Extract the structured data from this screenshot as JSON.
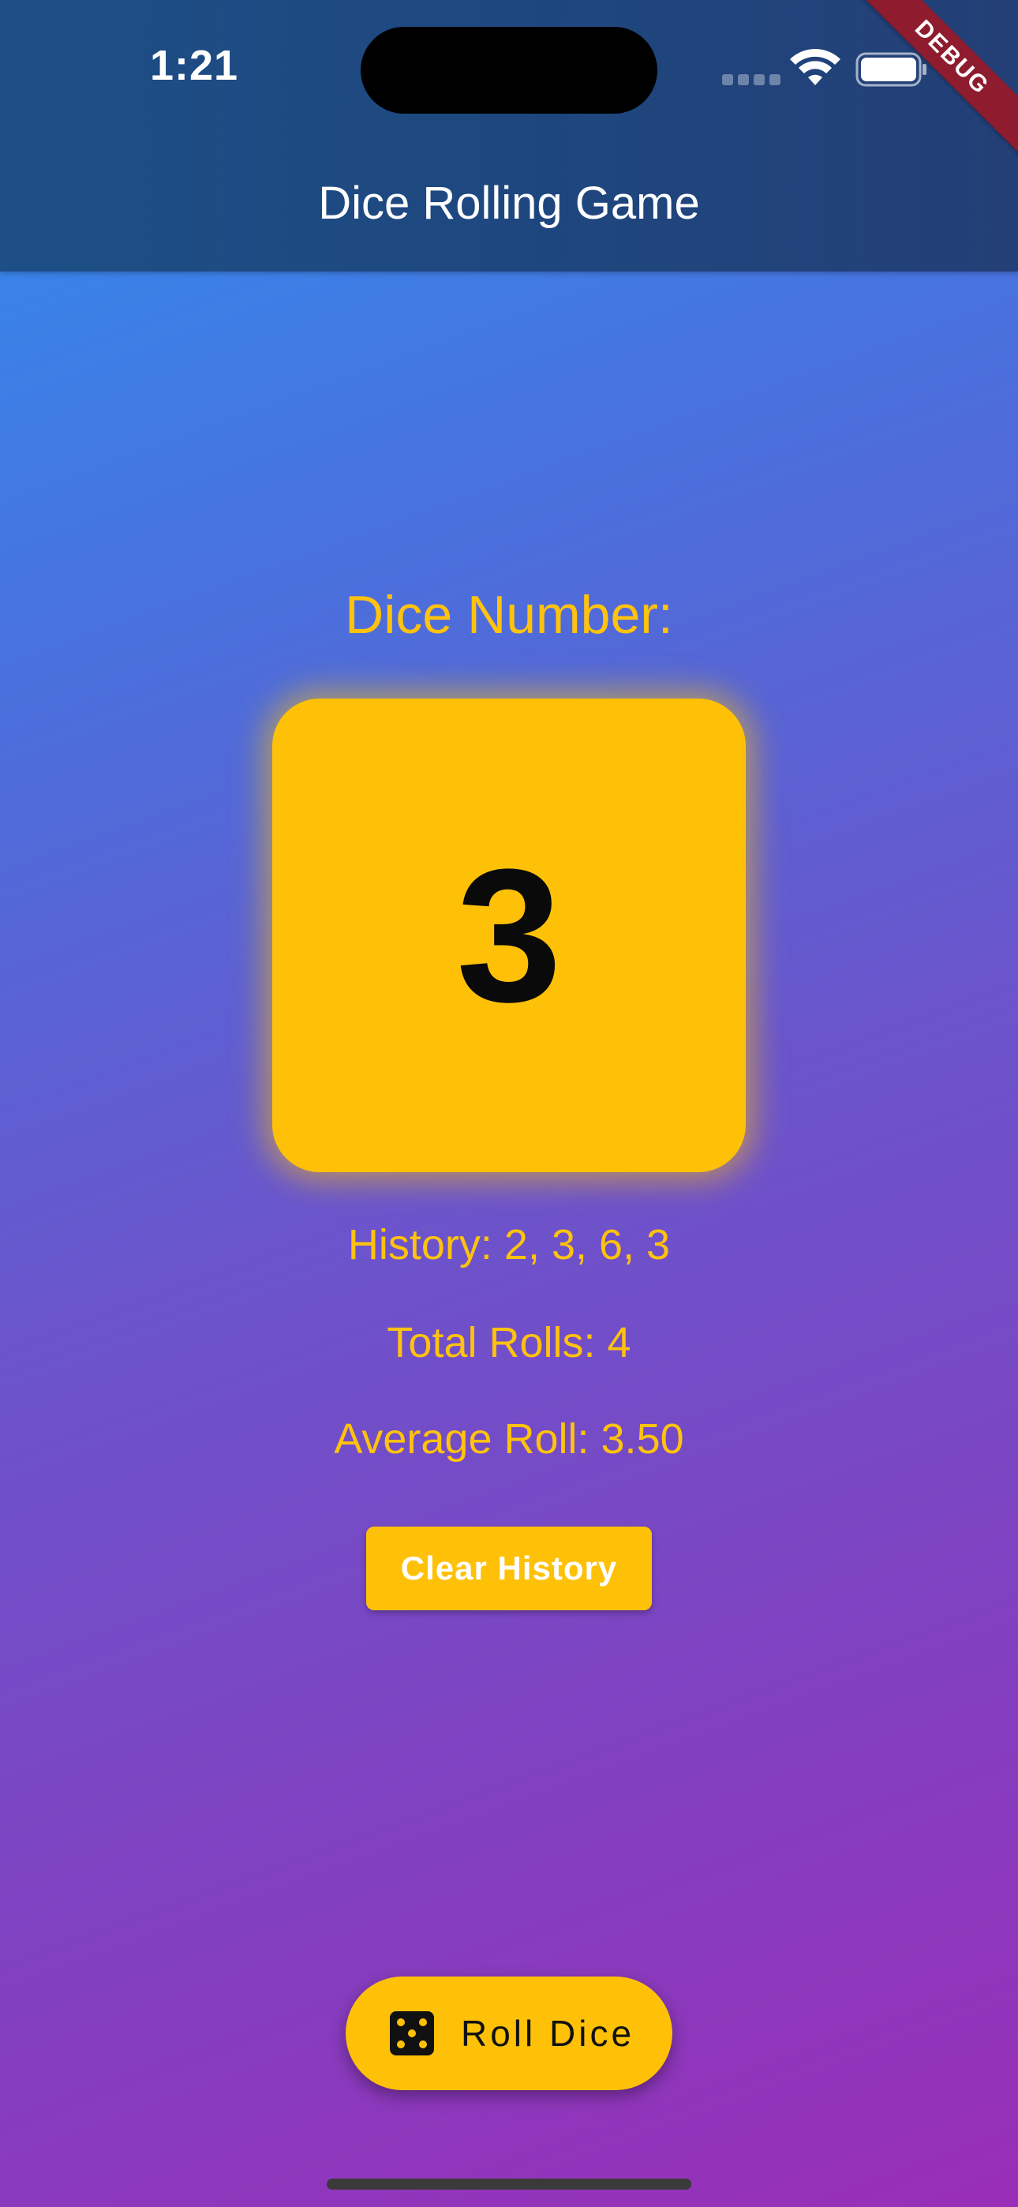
{
  "status_bar": {
    "time": "1:21"
  },
  "debug_banner": "DEBUG",
  "app_bar": {
    "title": "Dice Rolling Game"
  },
  "dice": {
    "label": "Dice Number:",
    "value": "3"
  },
  "stats": {
    "history": "History: 2, 3, 6, 3",
    "total_rolls": "Total Rolls: 4",
    "average_roll": "Average Roll: 3.50"
  },
  "buttons": {
    "clear_history": "Clear History",
    "roll_dice": "Roll Dice"
  },
  "icons": {
    "roll_dice_icon": "dice-five-icon",
    "wifi": "wifi-icon",
    "battery": "battery-icon"
  },
  "colors": {
    "accent": "#ffc107",
    "app_bar": "#1e4a80",
    "gradient_top": "#2e8ff0",
    "gradient_bottom": "#9a2eb8"
  }
}
